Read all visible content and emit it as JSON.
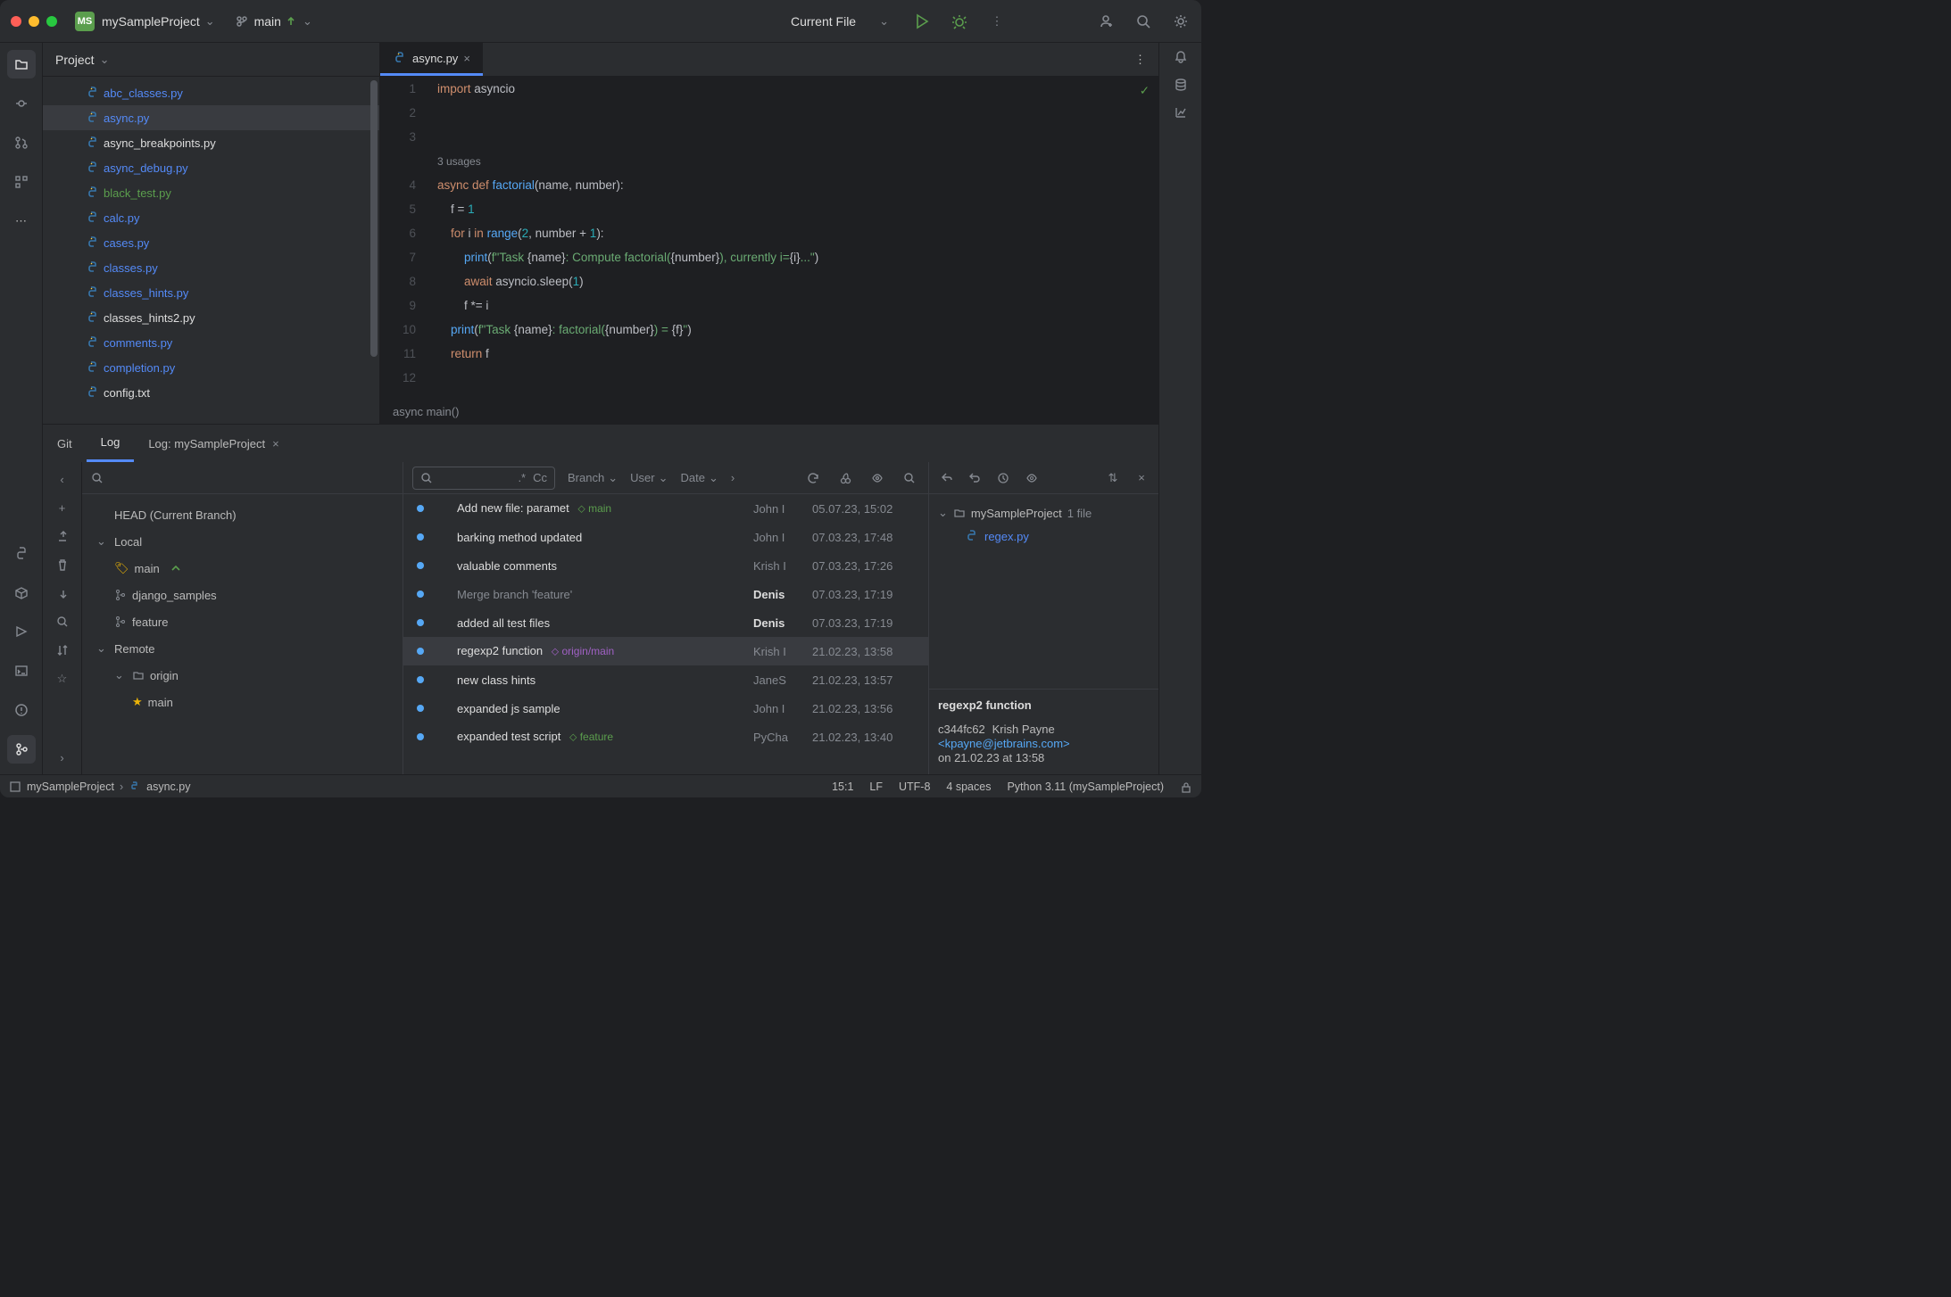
{
  "titlebar": {
    "project_badge": "MS",
    "project_name": "mySampleProject",
    "branch_name": "main",
    "run_config": "Current File"
  },
  "project_panel": {
    "title": "Project",
    "files": [
      {
        "name": "abc_classes.py",
        "color": "blue"
      },
      {
        "name": "async.py",
        "color": "blue",
        "selected": true
      },
      {
        "name": "async_breakpoints.py",
        "color": "white"
      },
      {
        "name": "async_debug.py",
        "color": "blue"
      },
      {
        "name": "black_test.py",
        "color": "green"
      },
      {
        "name": "calc.py",
        "color": "blue"
      },
      {
        "name": "cases.py",
        "color": "blue"
      },
      {
        "name": "classes.py",
        "color": "blue"
      },
      {
        "name": "classes_hints.py",
        "color": "blue"
      },
      {
        "name": "classes_hints2.py",
        "color": "white"
      },
      {
        "name": "comments.py",
        "color": "blue"
      },
      {
        "name": "completion.py",
        "color": "blue"
      },
      {
        "name": "config.txt",
        "color": "white"
      }
    ]
  },
  "editor": {
    "tab_name": "async.py",
    "usages_hint": "3 usages",
    "breadcrumb": "async main()",
    "line_numbers": [
      "1",
      "2",
      "3",
      "",
      "4",
      "5",
      "6",
      "7",
      "8",
      "9",
      "10",
      "11",
      "12"
    ]
  },
  "git_panel": {
    "tabs": {
      "git": "Git",
      "log": "Log",
      "log_project": "Log: mySampleProject"
    },
    "branches": {
      "head": "HEAD (Current Branch)",
      "local_label": "Local",
      "remote_label": "Remote",
      "local": [
        "main",
        "django_samples",
        "feature"
      ],
      "remote_origin": "origin",
      "remote_main": "main"
    },
    "filters": {
      "branch": "Branch",
      "user": "User",
      "date": "Date",
      "regex": ".*",
      "case": "Cc"
    },
    "log": [
      {
        "msg": "Add new file: paramet",
        "ref": "main",
        "ref_type": "main",
        "author": "John I",
        "date": "05.07.23, 15:02"
      },
      {
        "msg": "barking method updated",
        "author": "John I",
        "date": "07.03.23, 17:48"
      },
      {
        "msg": "valuable comments",
        "author": "Krish I",
        "date": "07.03.23, 17:26"
      },
      {
        "msg": "Merge branch 'feature'",
        "dim": true,
        "author": "Denis",
        "bold": true,
        "date": "07.03.23, 17:19"
      },
      {
        "msg": "added all test files",
        "author": "Denis",
        "bold": true,
        "date": "07.03.23, 17:19"
      },
      {
        "msg": "regexp2 function",
        "ref": "origin/main",
        "ref_type": "origin",
        "author": "Krish I",
        "date": "21.02.23, 13:58",
        "sel": true
      },
      {
        "msg": "new class hints",
        "author": "JaneS",
        "date": "21.02.23, 13:57"
      },
      {
        "msg": "expanded js sample",
        "author": "John I",
        "date": "21.02.23, 13:56"
      },
      {
        "msg": "expanded test script",
        "ref": "feature",
        "ref_type": "feature",
        "author": "PyCha",
        "date": "21.02.23, 13:40"
      }
    ],
    "detail": {
      "folder": "mySampleProject",
      "file_count": "1 file",
      "file": "regex.py",
      "commit_title": "regexp2 function",
      "hash": "c344fc62",
      "author_name": "Krish Payne",
      "author_email": "<kpayne@jetbrains.com>",
      "date_line": "on 21.02.23 at 13:58"
    }
  },
  "statusbar": {
    "crumb_project": "mySampleProject",
    "crumb_file": "async.py",
    "position": "15:1",
    "line_sep": "LF",
    "encoding": "UTF-8",
    "indent": "4 spaces",
    "interpreter": "Python 3.11 (mySampleProject)"
  }
}
